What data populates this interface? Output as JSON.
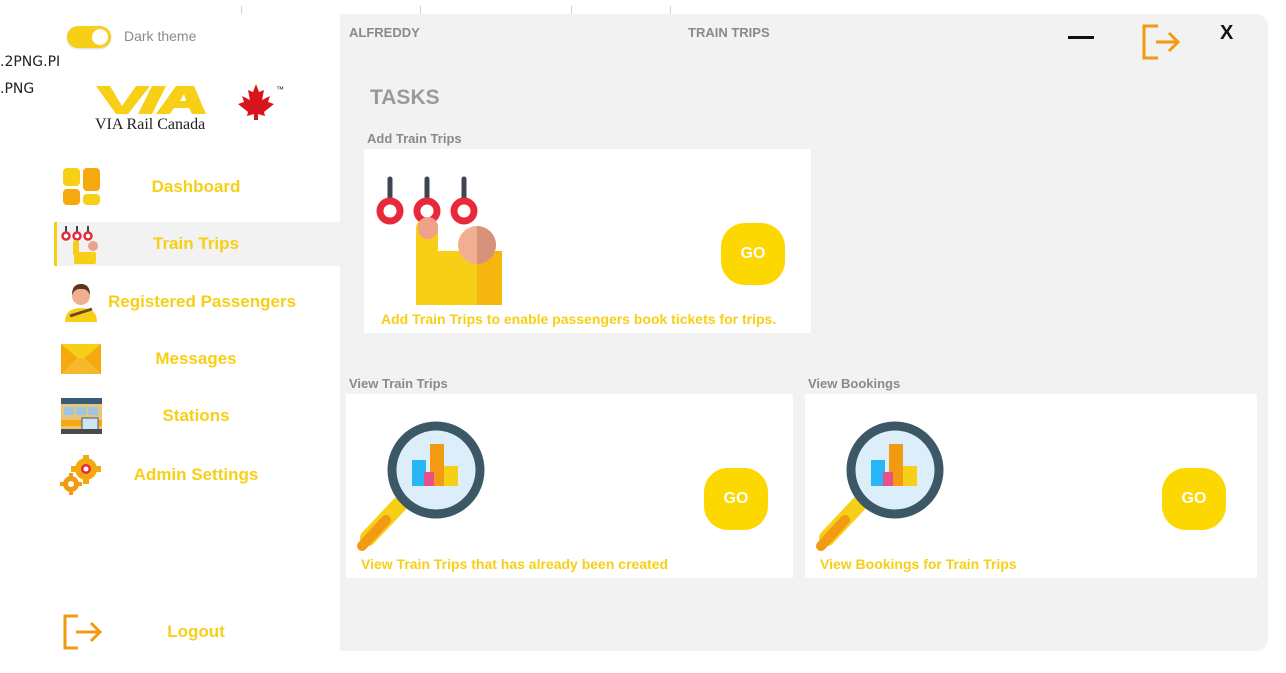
{
  "background": {
    "files": [
      ".2PNG.PI",
      ".PNG"
    ]
  },
  "theme": {
    "label": "Dark theme"
  },
  "logo": {
    "text": "VIA Rail Canada",
    "tm": "™"
  },
  "nav": {
    "items": [
      {
        "label": "Dashboard",
        "icon": "dashboard-icon"
      },
      {
        "label": "Train Trips",
        "icon": "train-trips-icon"
      },
      {
        "label": "Registered Passengers",
        "icon": "passenger-icon"
      },
      {
        "label": "Messages",
        "icon": "envelope-icon"
      },
      {
        "label": "Stations",
        "icon": "station-icon"
      },
      {
        "label": "Admin Settings",
        "icon": "gears-icon"
      }
    ],
    "logout_label": "Logout"
  },
  "header": {
    "user": "ALFREDDY",
    "title": "TRAIN TRIPS",
    "close_label": "X"
  },
  "main": {
    "tasks_title": "TASKS",
    "cards": [
      {
        "section": "Add Train Trips",
        "description": "Add Train Trips to enable passengers book tickets for trips.",
        "button": "GO"
      },
      {
        "section": "View Train Trips",
        "description": "View Train Trips that has already been created",
        "button": "GO"
      },
      {
        "section": "View Bookings",
        "description": "View Bookings for Train Trips",
        "button": "GO"
      }
    ]
  },
  "colors": {
    "accent": "#f7cf16",
    "go_button": "#fcd700",
    "panel": "#f2f2f2",
    "logout_orange": "#f29a12"
  }
}
